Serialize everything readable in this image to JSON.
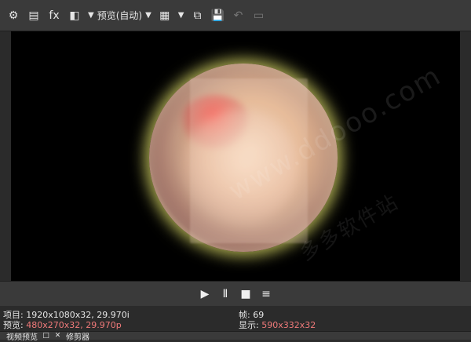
{
  "toolbar": {
    "preview_mode_label": "预览(自动)"
  },
  "transport": {
    "play_label": "▶",
    "pause_label": "Ⅱ",
    "stop_label": "■",
    "menu_label": "≡"
  },
  "info": {
    "project_key": "项目:",
    "project_value": "1920x1080x32, 29.970i",
    "preview_key": "预览:",
    "preview_value": "480x270x32, 29.970p",
    "frame_key": "帧:",
    "frame_value": "69",
    "display_key": "显示:",
    "display_value": "590x332x32"
  },
  "tabs": {
    "video_preview": "视频预览",
    "trimmer": "修剪器"
  },
  "watermark": {
    "text": "www.ddooo.com",
    "brand": "多多软件站"
  },
  "colors": {
    "accent_red": "#f07a7a",
    "toolbar_bg": "#3a3a3a",
    "preview_bg": "#000000"
  }
}
